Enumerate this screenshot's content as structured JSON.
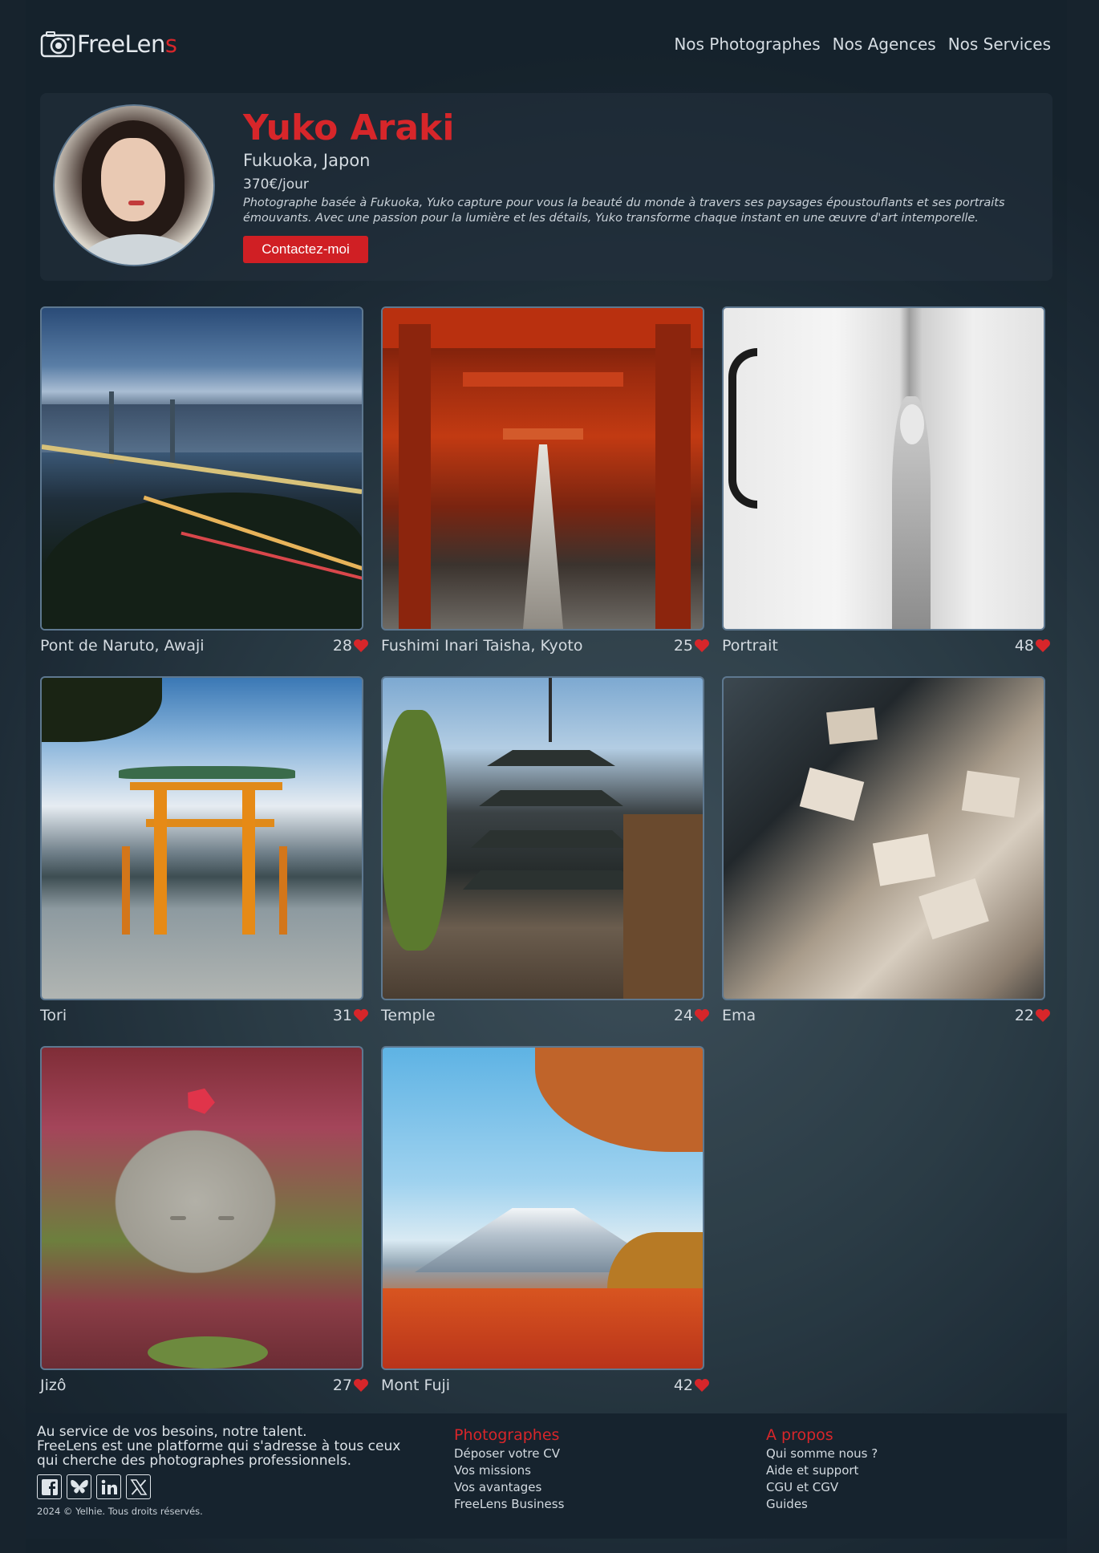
{
  "brand": {
    "name_main": "FreeLen",
    "name_accent": "s",
    "accent_color": "#d7262a"
  },
  "nav": [
    {
      "label": "Nos Photographes"
    },
    {
      "label": "Nos Agences"
    },
    {
      "label": "Nos Services"
    }
  ],
  "profile": {
    "name": "Yuko Araki",
    "location": "Fukuoka, Japon",
    "rate": "370€/jour",
    "bio": "Photographe basée à Fukuoka, Yuko capture pour vous la beauté du monde à travers ses paysages époustouflants et ses portraits émouvants. Avec une passion pour la lumière et les détails, Yuko transforme chaque instant en une œuvre d'art intemporelle.",
    "contact_label": "Contactez-moi"
  },
  "gallery": [
    {
      "title": "Pont de Naruto, Awaji",
      "likes": "28"
    },
    {
      "title": "Fushimi Inari Taisha, Kyoto",
      "likes": "25"
    },
    {
      "title": "Portrait",
      "likes": "48"
    },
    {
      "title": "Tori",
      "likes": "31"
    },
    {
      "title": "Temple",
      "likes": "24"
    },
    {
      "title": "Ema",
      "likes": "22"
    },
    {
      "title": "Jizô",
      "likes": "27"
    },
    {
      "title": "Mont Fuji",
      "likes": "42"
    }
  ],
  "footer": {
    "tagline": "Au service de vos besoins, notre talent.",
    "description": "FreeLens est une platforme qui s'adresse à tous ceux qui cherche des photographes professionnels.",
    "copyright": "2024 © Yelhie. Tous droits réservés.",
    "socials": [
      "facebook-icon",
      "bluesky-icon",
      "linkedin-icon",
      "x-icon"
    ],
    "photographes": {
      "title": "Photographes",
      "links": [
        "Déposer votre CV",
        "Vos missions",
        "Vos avantages",
        "FreeLens Business"
      ]
    },
    "apropos": {
      "title": "A propos",
      "links": [
        "Qui somme nous ?",
        "Aide et support",
        "CGU et CGV",
        "Guides"
      ]
    }
  }
}
